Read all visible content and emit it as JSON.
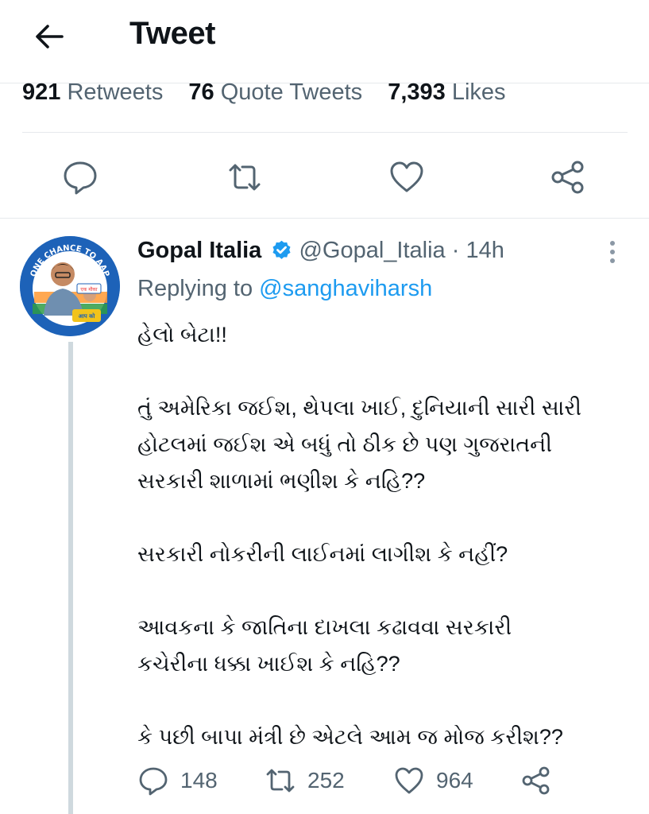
{
  "header": {
    "title": "Tweet",
    "back_icon": "back-arrow-icon"
  },
  "stats": [
    {
      "count": "921",
      "label": "Retweets"
    },
    {
      "count": "76",
      "label": "Quote Tweets"
    },
    {
      "count": "7,393",
      "label": "Likes"
    }
  ],
  "main_actions": [
    "reply-icon",
    "retweet-icon",
    "like-icon",
    "share-icon"
  ],
  "reply": {
    "display_name": "Gopal Italia",
    "verified": true,
    "handle": "@Gopal_Italia",
    "separator": "·",
    "time": "14h",
    "replying_prefix": "Replying to",
    "replying_to": "@sanghaviharsh",
    "avatar": {
      "ring_text": "ONE CHANCE TO AAP",
      "badge_text_1": "एक मौका",
      "badge_text_2": "आप को"
    },
    "body": [
      "હેલો બેટા!!",
      "તું અમેરિકા જઈશ, થેપલા ખાઈ, દુનિયાની સારી સારી",
      "હોટલમાં જઈશ એ બધું તો ઠીક છે પણ ગુજરાતની",
      "સરકારી શાળામાં ભણીશ કે નહિ??",
      "સરકારી નોકરીની લાઈનમાં લાગીશ કે નહીં?",
      "આવકના કે જાતિના દાખલા કઢાવવા સરકારી",
      "કચેરીના ધક્કા ખાઈશ કે નહિ??",
      "કે પછી બાપા મંત્રી છે એટલે આમ જ મોજ કરીશ??"
    ],
    "counts": {
      "replies": "148",
      "retweets": "252",
      "likes": "964"
    }
  },
  "colors": {
    "accent": "#1d9bf0",
    "secondary_text": "#536471",
    "divider": "#e6e9ec"
  }
}
